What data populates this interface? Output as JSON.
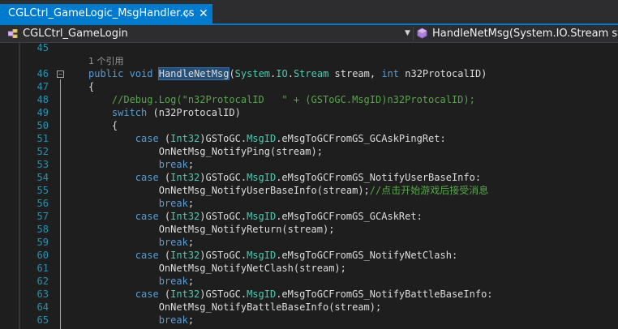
{
  "tab": {
    "title": "CGLCtrl_GameLogic_MsgHandler.cs",
    "pin_glyph": "⊹",
    "close_glyph": "✕"
  },
  "navbar": {
    "class_name": "CGLCtrl_GameLogin",
    "method_name": "HandleNetMsg(System.IO.Stream strean",
    "dropdown_glyph": "▼"
  },
  "editor": {
    "references_label": "1 个引用",
    "lines": [
      {
        "n": "45",
        "tokens": []
      },
      {
        "n": "",
        "tokens": [
          {
            "c": "cl",
            "t": "1 个引用"
          }
        ]
      },
      {
        "n": "46",
        "tokens": [
          {
            "c": "kw",
            "t": "public"
          },
          {
            "c": "pl",
            "t": " "
          },
          {
            "c": "kw",
            "t": "void"
          },
          {
            "c": "pl",
            "t": " "
          },
          {
            "c": "hl",
            "t": "HandleNetMsg"
          },
          {
            "c": "pl",
            "t": "("
          },
          {
            "c": "ty",
            "t": "System"
          },
          {
            "c": "pl",
            "t": "."
          },
          {
            "c": "ty",
            "t": "IO"
          },
          {
            "c": "pl",
            "t": "."
          },
          {
            "c": "ty",
            "t": "Stream"
          },
          {
            "c": "pl",
            "t": " stream, "
          },
          {
            "c": "kw",
            "t": "int"
          },
          {
            "c": "pl",
            "t": " n32ProtocalID)"
          }
        ]
      },
      {
        "n": "47",
        "tokens": [
          {
            "c": "pl",
            "t": "{"
          }
        ]
      },
      {
        "n": "48",
        "tokens": [
          {
            "c": "cm",
            "t": "    //Debug.Log(\"n32ProtocalID   \" + (GSToGC.MsgID)n32ProtocalID);"
          }
        ]
      },
      {
        "n": "49",
        "tokens": [
          {
            "c": "pl",
            "t": "    "
          },
          {
            "c": "kw",
            "t": "switch"
          },
          {
            "c": "pl",
            "t": " (n32ProtocalID)"
          }
        ]
      },
      {
        "n": "50",
        "tokens": [
          {
            "c": "pl",
            "t": "    {"
          }
        ]
      },
      {
        "n": "51",
        "tokens": [
          {
            "c": "pl",
            "t": "        "
          },
          {
            "c": "kw",
            "t": "case"
          },
          {
            "c": "pl",
            "t": " ("
          },
          {
            "c": "ty",
            "t": "Int32"
          },
          {
            "c": "pl",
            "t": ")GSToGC."
          },
          {
            "c": "ty",
            "t": "MsgID"
          },
          {
            "c": "pl",
            "t": ".eMsgToGCFromGS_GCAskPingRet:"
          }
        ]
      },
      {
        "n": "52",
        "tokens": [
          {
            "c": "pl",
            "t": "            OnNetMsg_NotifyPing(stream);"
          }
        ]
      },
      {
        "n": "53",
        "tokens": [
          {
            "c": "pl",
            "t": "            "
          },
          {
            "c": "kw",
            "t": "break"
          },
          {
            "c": "pl",
            "t": ";"
          }
        ]
      },
      {
        "n": "54",
        "tokens": [
          {
            "c": "pl",
            "t": "        "
          },
          {
            "c": "kw",
            "t": "case"
          },
          {
            "c": "pl",
            "t": " ("
          },
          {
            "c": "ty",
            "t": "Int32"
          },
          {
            "c": "pl",
            "t": ")GSToGC."
          },
          {
            "c": "ty",
            "t": "MsgID"
          },
          {
            "c": "pl",
            "t": ".eMsgToGCFromGS_NotifyUserBaseInfo:"
          }
        ]
      },
      {
        "n": "55",
        "tokens": [
          {
            "c": "pl",
            "t": "            OnNetMsg_NotifyUserBaseInfo(stream);"
          },
          {
            "c": "cm2",
            "t": "//点击开始游戏后接受消息"
          }
        ]
      },
      {
        "n": "56",
        "tokens": [
          {
            "c": "pl",
            "t": "            "
          },
          {
            "c": "kw",
            "t": "break"
          },
          {
            "c": "pl",
            "t": ";"
          }
        ]
      },
      {
        "n": "57",
        "tokens": [
          {
            "c": "pl",
            "t": "        "
          },
          {
            "c": "kw",
            "t": "case"
          },
          {
            "c": "pl",
            "t": " ("
          },
          {
            "c": "ty",
            "t": "Int32"
          },
          {
            "c": "pl",
            "t": ")GSToGC."
          },
          {
            "c": "ty",
            "t": "MsgID"
          },
          {
            "c": "pl",
            "t": ".eMsgToGCFromGS_GCAskRet:"
          }
        ]
      },
      {
        "n": "58",
        "tokens": [
          {
            "c": "pl",
            "t": "            OnNetMsg_NotifyReturn(stream);"
          }
        ]
      },
      {
        "n": "59",
        "tokens": [
          {
            "c": "pl",
            "t": "            "
          },
          {
            "c": "kw",
            "t": "break"
          },
          {
            "c": "pl",
            "t": ";"
          }
        ]
      },
      {
        "n": "60",
        "tokens": [
          {
            "c": "pl",
            "t": "        "
          },
          {
            "c": "kw",
            "t": "case"
          },
          {
            "c": "pl",
            "t": " ("
          },
          {
            "c": "ty",
            "t": "Int32"
          },
          {
            "c": "pl",
            "t": ")GSToGC."
          },
          {
            "c": "ty",
            "t": "MsgID"
          },
          {
            "c": "pl",
            "t": ".eMsgToGCFromGS_NotifyNetClash:"
          }
        ]
      },
      {
        "n": "61",
        "tokens": [
          {
            "c": "pl",
            "t": "            OnNetMsg_NotifyNetClash(stream);"
          }
        ]
      },
      {
        "n": "62",
        "tokens": [
          {
            "c": "pl",
            "t": "            "
          },
          {
            "c": "kw",
            "t": "break"
          },
          {
            "c": "pl",
            "t": ";"
          }
        ]
      },
      {
        "n": "63",
        "tokens": [
          {
            "c": "pl",
            "t": "        "
          },
          {
            "c": "kw",
            "t": "case"
          },
          {
            "c": "pl",
            "t": " ("
          },
          {
            "c": "ty",
            "t": "Int32"
          },
          {
            "c": "pl",
            "t": ")GSToGC."
          },
          {
            "c": "ty",
            "t": "MsgID"
          },
          {
            "c": "pl",
            "t": ".eMsgToGCFromGS_NotifyBattleBaseInfo:"
          }
        ]
      },
      {
        "n": "64",
        "tokens": [
          {
            "c": "pl",
            "t": "            OnNetMsg_NotifyBattleBaseInfo(stream);"
          }
        ]
      },
      {
        "n": "65",
        "tokens": [
          {
            "c": "pl",
            "t": "            "
          },
          {
            "c": "kw",
            "t": "break"
          },
          {
            "c": "pl",
            "t": ";"
          }
        ]
      }
    ]
  },
  "colors": {
    "accent": "#007acc",
    "keyword": "#569cd6",
    "type": "#4ec9b0",
    "comment": "#57a64a",
    "line_number": "#2b91af",
    "background": "#1e1e1e"
  }
}
